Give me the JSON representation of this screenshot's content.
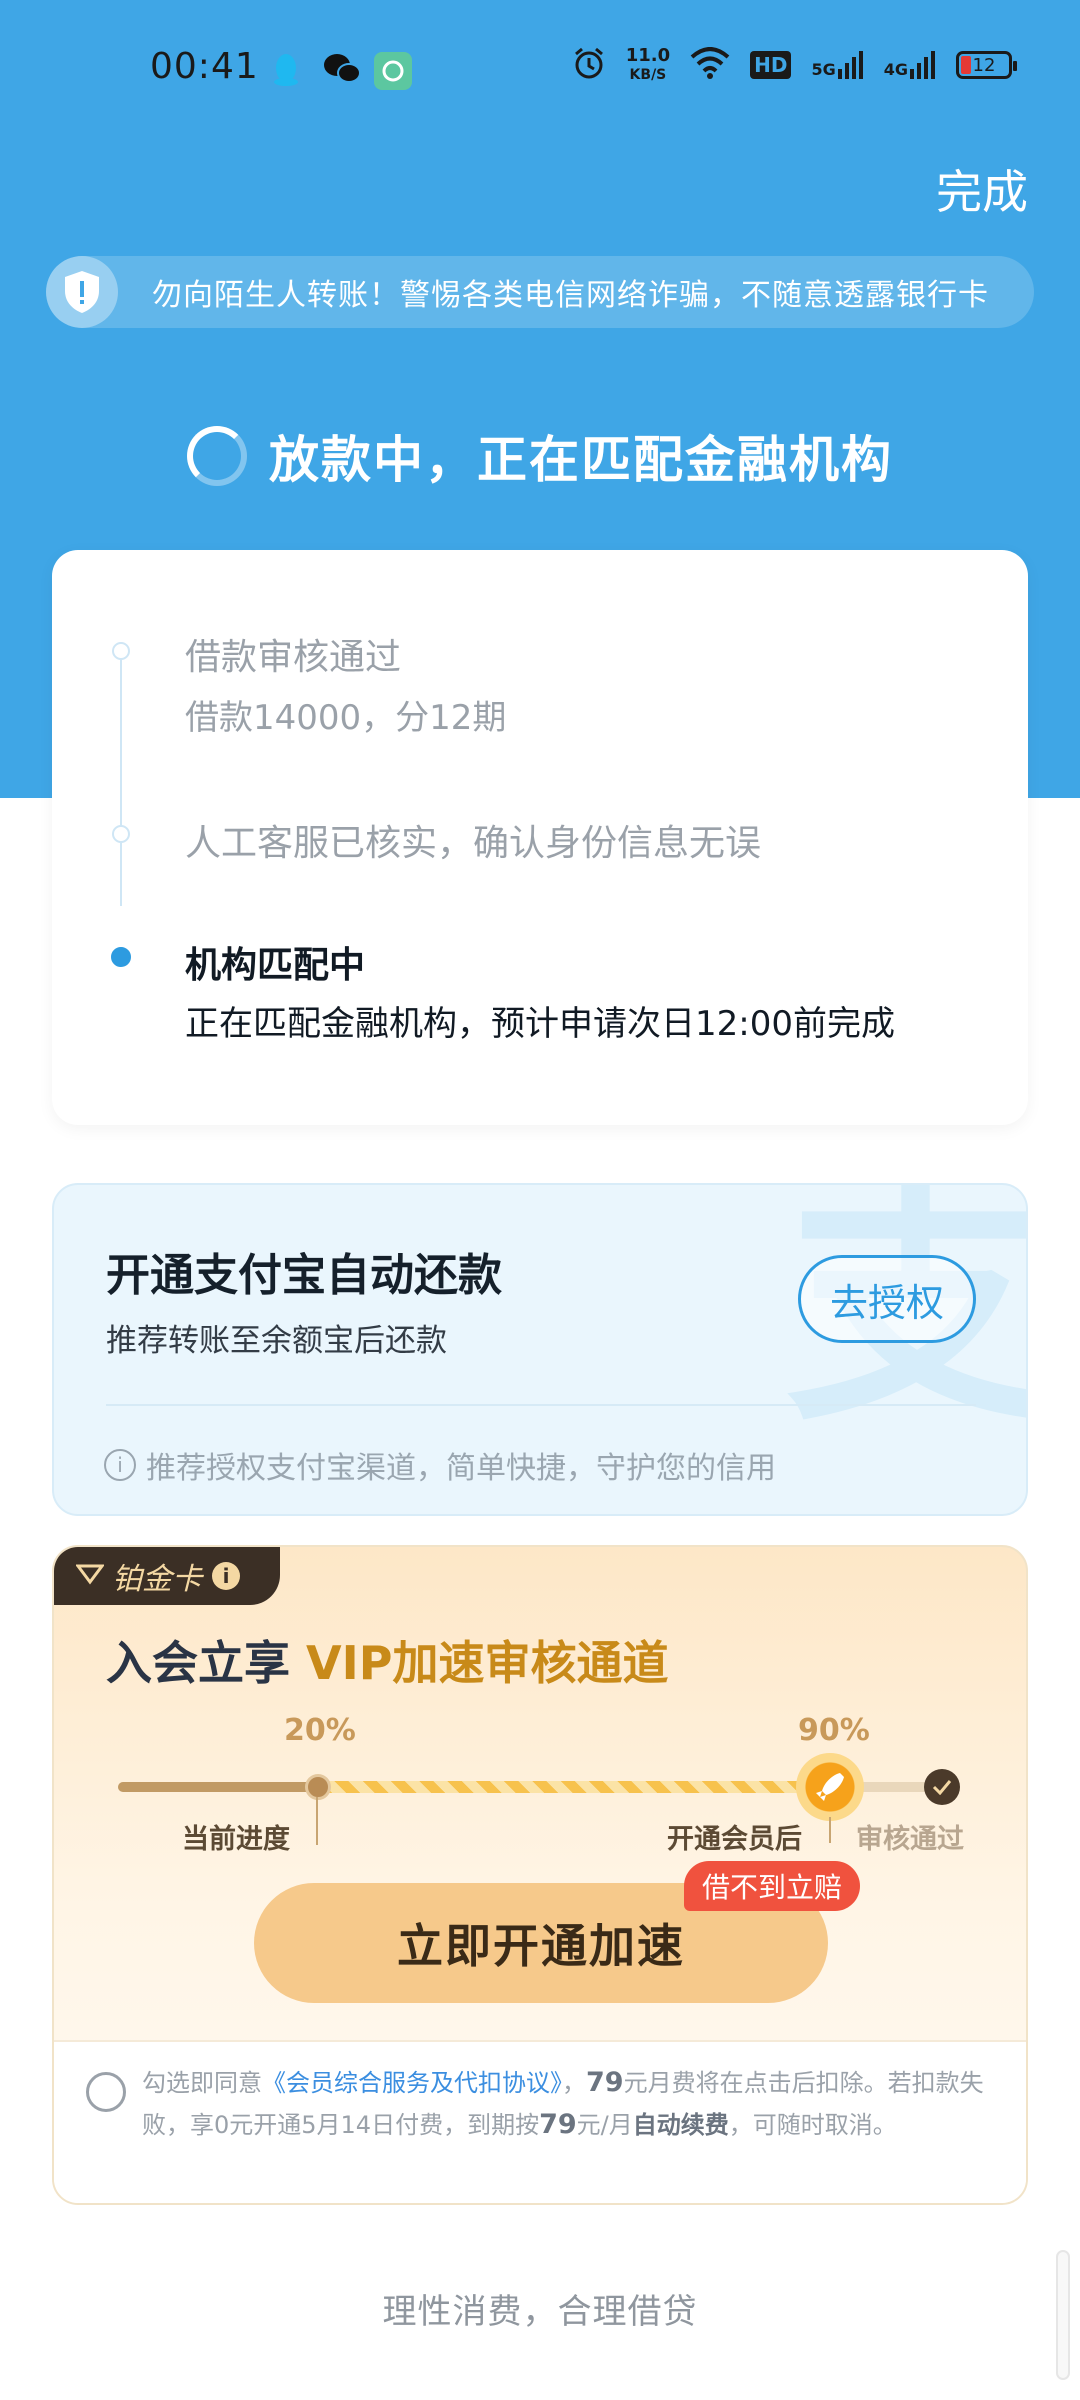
{
  "status_bar": {
    "time": "00:41",
    "net_speed_value": "11.0",
    "net_speed_unit": "KB/S",
    "hd_label": "HD",
    "sim1_label": "5G",
    "sim2_label": "4G",
    "battery": "12"
  },
  "header": {
    "done_label": "完成",
    "warning_text": "勿向陌生人转账！警惕各类电信网络诈骗，不随意透露银行卡",
    "status_title": "放款中，正在匹配金融机构"
  },
  "timeline": {
    "steps": [
      {
        "title": "借款审核通过",
        "sub": "借款14000，分12期"
      },
      {
        "title": "人工客服已核实，确认身份信息无误"
      },
      {
        "title": "机构匹配中",
        "sub": "正在匹配金融机构，预计申请次日12:00前完成"
      }
    ]
  },
  "alipay": {
    "title": "开通支付宝自动还款",
    "subtitle": "推荐转账至余额宝后还款",
    "auth_button": "去授权",
    "tip": "推荐授权支付宝渠道，简单快捷，守护您的信用",
    "watermark": "支"
  },
  "vip": {
    "tag_label": "铂金卡",
    "title_prefix": "入会立享 ",
    "title_highlight": "VIP加速审核通道",
    "current_percent": "20%",
    "after_percent": "90%",
    "progress_current": 0.2,
    "progress_after": 0.9,
    "labels": {
      "current": "当前进度",
      "after": "开通会员后",
      "passed": "审核通过"
    },
    "accelerate_button": "立即开通加速",
    "badge": "借不到立赔",
    "agreement": {
      "prefix": "勾选即同意",
      "link": "《会员综合服务及代扣协议》",
      "sep": "，",
      "fee": "79",
      "mid1": "元月费将在点击后扣除。若扣款失败，享0元开通5月14日付费，到期按",
      "fee2": "79",
      "mid2": "元/月",
      "auto_renew": "自动续费",
      "suffix": "，可随时取消。"
    }
  },
  "footer": {
    "text": "理性消费，合理借贷"
  },
  "colors": {
    "header_blue": "#3fa6e6",
    "accent_blue": "#2d9be0",
    "gold": "#c88a19",
    "badge_red": "#f0523e"
  }
}
